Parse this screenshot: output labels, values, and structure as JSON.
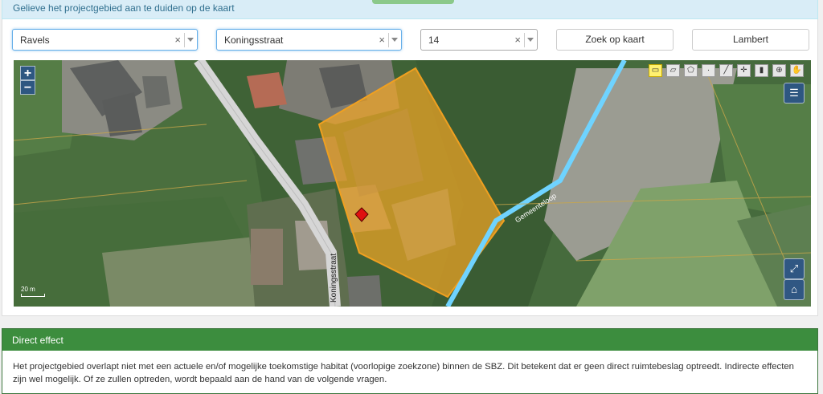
{
  "banner": {
    "text": "Gelieve het projectgebied aan te duiden op de kaart"
  },
  "search": {
    "municipality": "Ravels",
    "street": "Koningsstraat",
    "number": "14",
    "clear_glyph": "×",
    "search_button": "Zoek op kaart",
    "projection_button": "Lambert"
  },
  "map": {
    "zoom_in": "+",
    "zoom_out": "−",
    "scale_label": "20 m",
    "street_label": "Koningsstraat",
    "watercourse_label": "Gemeenteloop",
    "tools": [
      "comment-icon",
      "rectangle-icon",
      "polygon-icon",
      "point-icon",
      "line-icon",
      "move-icon",
      "trash-icon",
      "zoom-area-icon",
      "pan-hand-icon"
    ],
    "colors": {
      "project_area": "#f5a623",
      "watercourse": "#6fd3ff",
      "road": "#d9d9d9"
    }
  },
  "effect": {
    "title": "Direct effect",
    "text": "Het projectgebied overlapt niet met een actuele en/of mogelijke toekomstige habitat (voorlopige zoekzone) binnen de SBZ. Dit betekent dat er geen direct ruimtebeslag optreedt. Indirecte effecten zijn wel mogelijk. Of ze zullen optreden, wordt bepaald aan de hand van de volgende vragen."
  }
}
